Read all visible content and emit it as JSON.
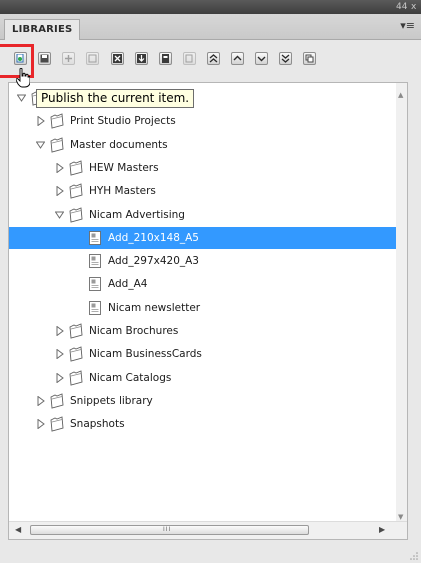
{
  "title_strip": {
    "collapse_glyph": "44",
    "close_glyph": "x"
  },
  "panel": {
    "tab_label": "LIBRARIES",
    "menu_glyph": "▾≡"
  },
  "toolbar": {
    "buttons": [
      {
        "icon": "publish-icon",
        "enabled": true
      },
      {
        "icon": "save-icon",
        "enabled": true
      },
      {
        "icon": "add-icon",
        "enabled": false
      },
      {
        "icon": "properties-icon",
        "enabled": false
      },
      {
        "icon": "delete-icon",
        "enabled": true
      },
      {
        "icon": "import-icon",
        "enabled": true
      },
      {
        "icon": "export-icon",
        "enabled": true
      },
      {
        "icon": "copy-icon",
        "enabled": false
      },
      {
        "icon": "collapse-all-icon",
        "enabled": true
      },
      {
        "icon": "move-up-icon",
        "enabled": true
      },
      {
        "icon": "move-down-icon",
        "enabled": true
      },
      {
        "icon": "expand-all-icon",
        "enabled": true
      },
      {
        "icon": "refresh-icon",
        "enabled": true
      }
    ]
  },
  "tooltip": {
    "text": "Publish the current item."
  },
  "tree": {
    "items": [
      {
        "label": "",
        "level": 0,
        "type": "folder",
        "expanded": true
      },
      {
        "label": "Print Studio Projects",
        "level": 1,
        "type": "folder",
        "expanded": false
      },
      {
        "label": "Master documents",
        "level": 1,
        "type": "folder",
        "expanded": true
      },
      {
        "label": "HEW Masters",
        "level": 2,
        "type": "folder",
        "expanded": false
      },
      {
        "label": "HYH Masters",
        "level": 2,
        "type": "folder",
        "expanded": false
      },
      {
        "label": "Nicam Advertising",
        "level": 2,
        "type": "folder",
        "expanded": true
      },
      {
        "label": "Add_210x148_A5",
        "level": 3,
        "type": "document",
        "selected": true
      },
      {
        "label": "Add_297x420_A3",
        "level": 3,
        "type": "document"
      },
      {
        "label": "Add_A4",
        "level": 3,
        "type": "document"
      },
      {
        "label": "Nicam newsletter",
        "level": 3,
        "type": "document"
      },
      {
        "label": "Nicam Brochures",
        "level": 2,
        "type": "folder",
        "expanded": false
      },
      {
        "label": "Nicam BusinessCards",
        "level": 2,
        "type": "folder",
        "expanded": false
      },
      {
        "label": "Nicam Catalogs",
        "level": 2,
        "type": "folder",
        "expanded": false
      },
      {
        "label": "Snippets library",
        "level": 1,
        "type": "folder",
        "expanded": false
      },
      {
        "label": "Snapshots",
        "level": 1,
        "type": "folder",
        "expanded": false
      }
    ]
  },
  "hscroll": {
    "grip": "III"
  },
  "colors": {
    "selection": "#3399ff",
    "highlight_box": "#e8262a",
    "tooltip_bg": "#ffffe1"
  }
}
